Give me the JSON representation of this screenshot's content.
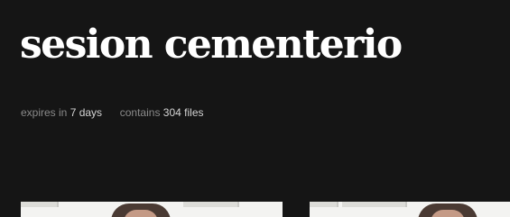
{
  "album": {
    "title": "sesion cementerio"
  },
  "meta": {
    "expires_label": "expires in",
    "expires_value": "7 days",
    "contains_label": "contains",
    "contains_value": "304 files"
  },
  "gallery": {
    "thumbnail_count_visible": 2
  },
  "colors": {
    "background": "#151515",
    "title": "#ffffff",
    "meta_label": "#8a8a8a",
    "meta_value": "#d4d4d4"
  }
}
